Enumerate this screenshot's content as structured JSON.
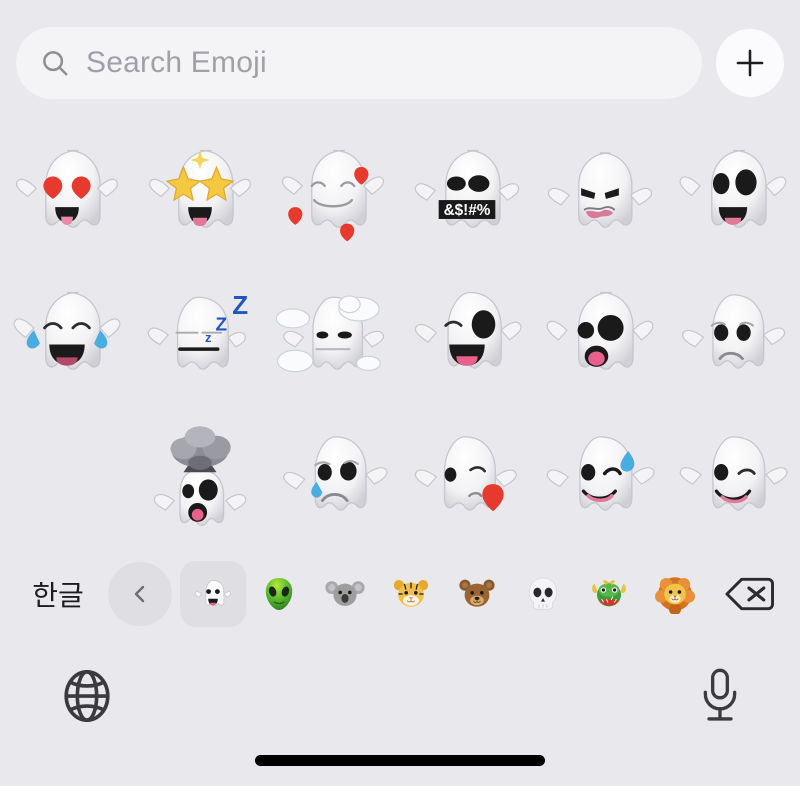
{
  "app": {
    "name": "iOS Emoji Keyboard",
    "background_color": "#e8e8ed"
  },
  "search": {
    "placeholder": "Search Emoji",
    "value": "",
    "icon": "search-icon",
    "field_color": "#f4f4f7",
    "placeholder_color": "#a0a0a8"
  },
  "add_button": {
    "icon": "plus-icon",
    "label": "+",
    "background_color": "#fbfbfd"
  },
  "grid": {
    "columns": 6,
    "rows": [
      {
        "items": [
          {
            "name": "ghost-heart-eyes",
            "label": "Ghost with heart eyes"
          },
          {
            "name": "ghost-star-struck",
            "label": "Star-struck ghost"
          },
          {
            "name": "ghost-smiling-hearts",
            "label": "Ghost smiling with hearts"
          },
          {
            "name": "ghost-cursing",
            "label": "Ghost cursing",
            "censor_text": "&$!#%"
          },
          {
            "name": "ghost-angry",
            "label": "Angry ghost"
          },
          {
            "name": "ghost-grinning",
            "label": "Grinning ghost"
          }
        ]
      },
      {
        "items": [
          {
            "name": "ghost-tears-of-joy",
            "label": "Ghost with tears of joy"
          },
          {
            "name": "ghost-sleeping",
            "label": "Sleeping ghost",
            "zzz_text": "Z"
          },
          {
            "name": "ghost-head-in-clouds",
            "label": "Ghost head in clouds"
          },
          {
            "name": "ghost-winking-tongue",
            "label": "Winking ghost with tongue"
          },
          {
            "name": "ghost-shocked",
            "label": "Shocked ghost"
          },
          {
            "name": "ghost-sad",
            "label": "Sad ghost"
          }
        ]
      },
      {
        "items": [
          {
            "name": "empty-slot",
            "label": ""
          },
          {
            "name": "ghost-exploding-head",
            "label": "Ghost with exploding head"
          },
          {
            "name": "ghost-crying",
            "label": "Crying ghost"
          },
          {
            "name": "ghost-kiss-heart",
            "label": "Ghost blowing a kiss"
          },
          {
            "name": "ghost-sweat-smile",
            "label": "Ghost with sweat smile"
          },
          {
            "name": "ghost-wink",
            "label": "Winking ghost"
          }
        ]
      }
    ]
  },
  "category_bar": {
    "language_key": "한글",
    "back_button": {
      "icon": "chevron-left-icon",
      "label": "Previous"
    },
    "categories": [
      {
        "name": "category-ghost",
        "emoji": "👻",
        "selected": true
      },
      {
        "name": "category-alien",
        "emoji": "👽",
        "selected": false
      },
      {
        "name": "category-koala",
        "emoji": "🐨",
        "selected": false
      },
      {
        "name": "category-tiger",
        "emoji": "🐯",
        "selected": false
      },
      {
        "name": "category-bear",
        "emoji": "🐻",
        "selected": false
      },
      {
        "name": "category-skull",
        "emoji": "💀",
        "selected": false
      },
      {
        "name": "category-dragon",
        "emoji": "🐲",
        "selected": false
      },
      {
        "name": "category-lion",
        "emoji": "🦁",
        "selected": false
      }
    ],
    "delete_key": {
      "icon": "delete-backspace-icon",
      "label": "Delete"
    }
  },
  "bottom_bar": {
    "globe": {
      "icon": "globe-icon",
      "label": "Next keyboard"
    },
    "microphone": {
      "icon": "microphone-icon",
      "label": "Dictation"
    }
  },
  "home_indicator": {
    "name": "home-indicator",
    "color": "#000000"
  }
}
